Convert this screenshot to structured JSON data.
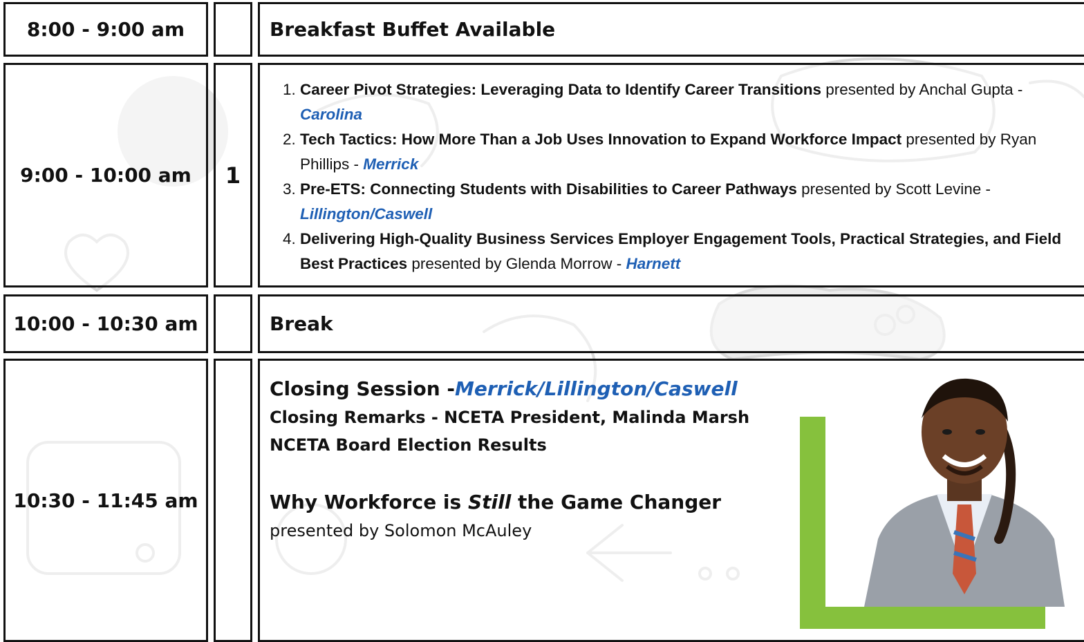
{
  "colors": {
    "accent_blue": "#1e5fb4",
    "accent_green": "#86c13d",
    "border": "#111111"
  },
  "rows": [
    {
      "time": "8:00 - 9:00 am",
      "number": "",
      "title": "Breakfast Buffet Available"
    },
    {
      "time": "9:00 - 10:00 am",
      "number": "1",
      "sessions": [
        {
          "n": "1.",
          "title": "Career Pivot Strategies: Leveraging Data to Identify Career Transitions",
          "by": " presented by Anchal Gupta - ",
          "location": "Carolina"
        },
        {
          "n": "2.",
          "title": "Tech Tactics: How More Than a Job Uses Innovation to Expand Workforce Impact",
          "by": " presented by Ryan Phillips - ",
          "location": "Merrick"
        },
        {
          "n": "3.",
          "title": "Pre-ETS: Connecting Students with Disabilities to Career Pathways",
          "by": " presented by Scott Levine - ",
          "location": "Lillington/Caswell"
        },
        {
          "n": "4.",
          "title": "Delivering High-Quality Business Services Employer Engagement Tools, Practical Strategies, and Field Best Practices",
          "by": " presented by Glenda Morrow - ",
          "location": "Harnett"
        }
      ]
    },
    {
      "time": "10:00 - 10:30 am",
      "number": "",
      "title": "Break"
    },
    {
      "time": "10:30 - 11:45 am",
      "number": "",
      "closing": {
        "title": "Closing Session -",
        "location": "Merrick/Lillington/Caswell",
        "line2": "Closing Remarks - NCETA President, Malinda Marsh",
        "line3": "NCETA Board Election Results",
        "keynote_pre": "Why Workforce is ",
        "keynote_em": "Still",
        "keynote_post": " the Game Changer",
        "presenter": "presented by Solomon McAuley"
      },
      "photo": "presenter-photo"
    }
  ]
}
